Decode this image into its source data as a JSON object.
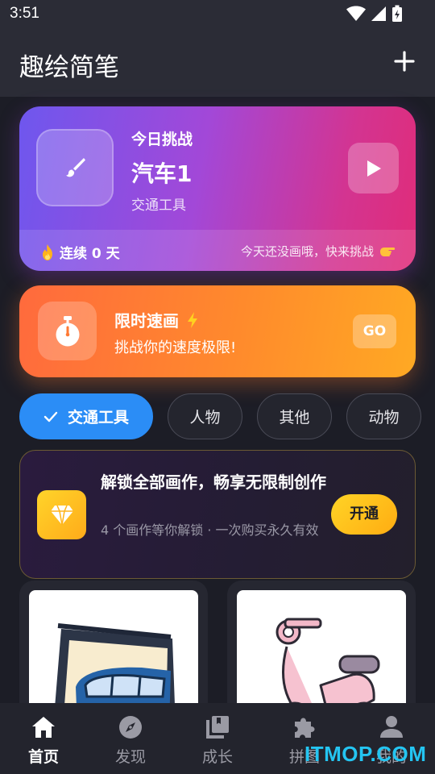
{
  "status_bar": {
    "time": "3:51"
  },
  "app_bar": {
    "title": "趣绘简笔"
  },
  "challenge": {
    "label": "今日挑战",
    "title": "汽车1",
    "category": "交通工具",
    "streak_text": "连续 0 天",
    "hint": "今天还没画哦，快来挑战"
  },
  "speed_draw": {
    "title": "限时速画",
    "subtitle": "挑战你的速度极限!",
    "go_label": "GO"
  },
  "chips": [
    {
      "label": "交通工具",
      "active": true
    },
    {
      "label": "人物",
      "active": false
    },
    {
      "label": "其他",
      "active": false
    },
    {
      "label": "动物",
      "active": false
    }
  ],
  "premium": {
    "title": "解锁全部画作，畅享无限制创作",
    "subtitle": "4 个画作等你解锁 · 一次购买永久有效",
    "button": "开通"
  },
  "bottom_nav": [
    {
      "label": "首页",
      "icon": "home-icon",
      "active": true
    },
    {
      "label": "发现",
      "icon": "compass-icon",
      "active": false
    },
    {
      "label": "成长",
      "icon": "library-icon",
      "active": false
    },
    {
      "label": "拼图",
      "icon": "puzzle-icon",
      "active": false
    },
    {
      "label": "我的",
      "icon": "person-icon",
      "active": false
    }
  ],
  "watermark": "ITMOP.COM",
  "colors": {
    "background": "#1c1d26",
    "accent_blue": "#2b8df6",
    "gold": "#ffc21a"
  }
}
